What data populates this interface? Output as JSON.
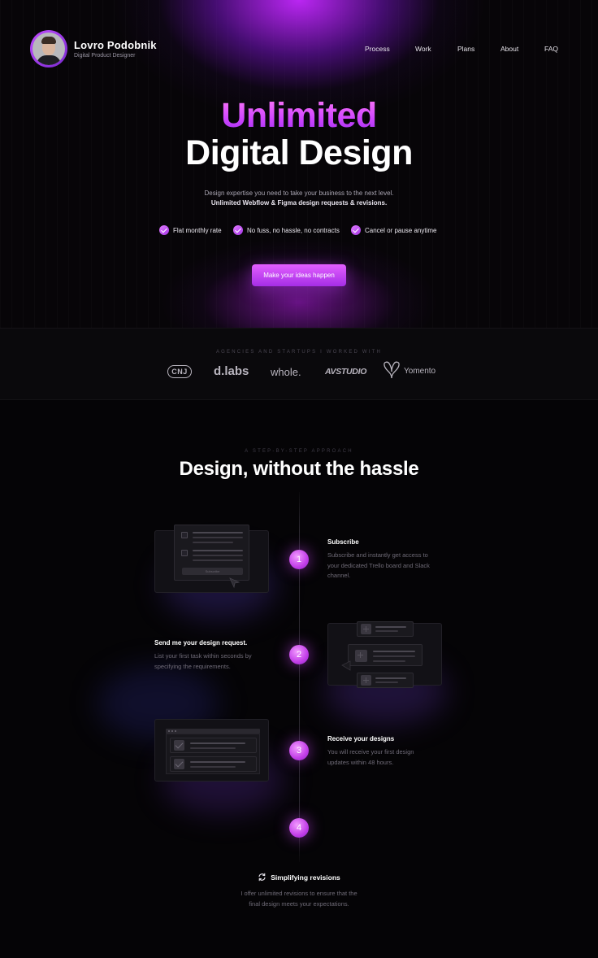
{
  "brand": {
    "name": "Lovro Podobnik",
    "subtitle": "Digital Product Designer"
  },
  "nav": {
    "items": [
      "Process",
      "Work",
      "Plans",
      "About",
      "FAQ"
    ]
  },
  "hero": {
    "headline_accent": "Unlimited",
    "headline_main": "Digital Design",
    "sub_line_1": "Design expertise you need to take your business to the next level.",
    "sub_line_2": "Unlimited Webflow & Figma design requests & revisions.",
    "features": [
      "Flat monthly rate",
      "No fuss, no hassle, no contracts",
      "Cancel or pause anytime"
    ],
    "cta_label": "Make your ideas happen"
  },
  "clients": {
    "label": "AGENCIES AND STARTUPS I WORKED WITH",
    "logos": [
      "CNJ",
      "d.labs",
      "whole.",
      "AVSTUDIO",
      "Yomento"
    ]
  },
  "process": {
    "eyebrow": "A STEP-BY-STEP APPROACH",
    "title": "Design, without the hassle",
    "steps": [
      {
        "number": "1",
        "title": "Subscribe",
        "description": [
          "Subscribe and instantly get access to",
          "your dedicated Trello board and Slack",
          "channel."
        ],
        "illustration_button": "Subscribe"
      },
      {
        "number": "2",
        "title": "Send me your design request.",
        "description": [
          "List your first task within seconds by",
          "specifying the requirements."
        ]
      },
      {
        "number": "3",
        "title": "Receive your designs",
        "description": [
          "You will receive your first design",
          "updates within 48 hours."
        ]
      },
      {
        "number": "4",
        "title": "Simplifying revisions",
        "description": [
          "I offer unlimited revisions to ensure that the",
          "final design meets your expectations."
        ]
      }
    ]
  },
  "colors": {
    "accent": "#c84bff",
    "background": "#050406"
  },
  "icons": {
    "revisions": "refresh-icon",
    "check": "check-circle-icon"
  }
}
